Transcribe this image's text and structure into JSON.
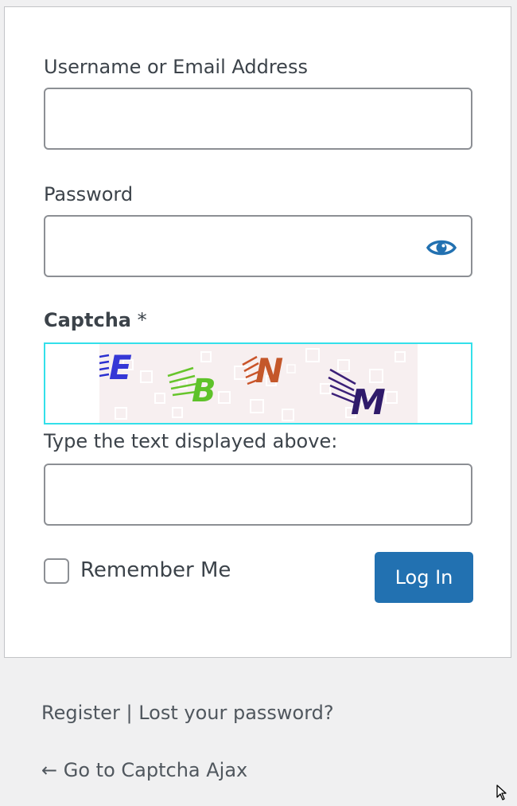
{
  "form": {
    "username_label": "Username or Email Address",
    "username_value": "",
    "password_label": "Password",
    "password_value": "",
    "show_password_icon": "eye-icon",
    "captcha_label": "Captcha",
    "captcha_required_mark": "*",
    "captcha_text": "EBNM",
    "captcha_prompt": "Type the text displayed above:",
    "captcha_value": "",
    "remember_label": "Remember Me",
    "remember_checked": false,
    "submit_label": "Log In"
  },
  "links": {
    "register": "Register",
    "separator": "|",
    "lost_password": "Lost your password?",
    "back_arrow": "←",
    "back_to_site": "Go to Captcha Ajax"
  },
  "colors": {
    "primary": "#2271b1",
    "captcha_border": "#33e0ea",
    "background": "#f0f0f1"
  }
}
